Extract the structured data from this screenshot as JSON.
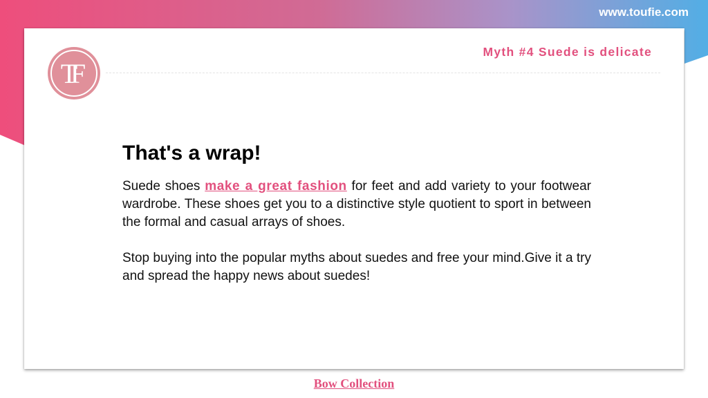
{
  "site": {
    "url": "www.toufie.com"
  },
  "logo": {
    "letter": "T",
    "letter2": "F"
  },
  "slide": {
    "title": "Myth #4 Suede is delicate"
  },
  "content": {
    "heading": "That's a wrap!",
    "paragraph1": {
      "before": "Suede shoes ",
      "link": "make a great fashion",
      "after": " for feet and add variety to your footwear wardrobe. These shoes get you to a distinctive style quotient to sport in between the formal and casual arrays of shoes."
    },
    "paragraph2": "Stop buying into the popular myths about suedes and free your mind.Give it a try and spread the happy news about suedes!"
  },
  "footer": {
    "link": "Bow Collection"
  },
  "colors": {
    "accent": "#e2507e",
    "gradient_pink": "#ec4f7f",
    "gradient_purple": "#b088c6",
    "gradient_blue": "#5aaee3",
    "logo_fill": "#e0909a"
  }
}
